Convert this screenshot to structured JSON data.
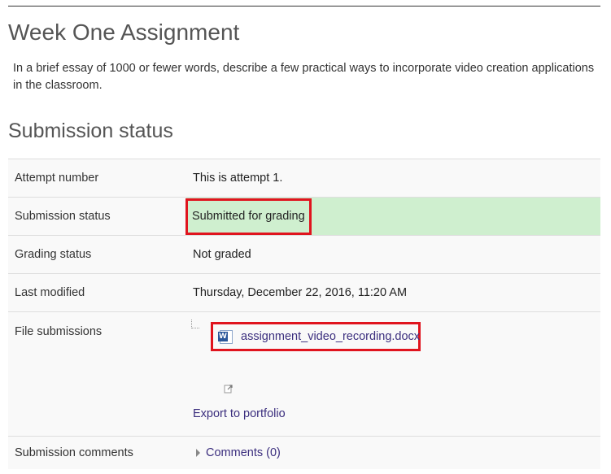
{
  "page": {
    "title": "Week One Assignment",
    "intro": "In a brief essay of 1000 or fewer words, describe a few practical ways to incorporate video creation applications in the classroom."
  },
  "submission": {
    "heading": "Submission status",
    "rows": {
      "attempt": {
        "label": "Attempt number",
        "value": "This is attempt 1."
      },
      "status": {
        "label": "Submission status",
        "value": "Submitted for grading"
      },
      "grading": {
        "label": "Grading status",
        "value": "Not graded"
      },
      "modified": {
        "label": "Last modified",
        "value": "Thursday, December 22, 2016, 11:20 AM"
      },
      "files": {
        "label": "File submissions",
        "file_name": "assignment_video_recording.docx",
        "file_icon": "word-doc-icon",
        "export_label": "Export to portfolio"
      },
      "comments": {
        "label": "Submission comments",
        "link": "Comments (0)"
      }
    }
  },
  "colors": {
    "submitted_bg": "#cfefcf",
    "highlight_border": "#e0141e",
    "link": "#3b2e7e"
  }
}
